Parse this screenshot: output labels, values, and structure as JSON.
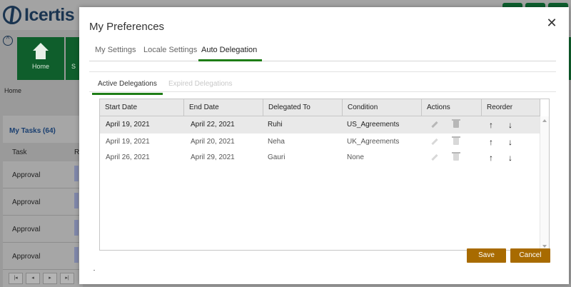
{
  "app": {
    "logo_text": "Icertis",
    "tiles": {
      "home": "Home",
      "second": "S"
    },
    "breadcrumb": "Home",
    "my_tasks": {
      "title": "My Tasks (64)",
      "columns": [
        "Task",
        "R"
      ],
      "rows": [
        {
          "task": "Approval"
        },
        {
          "task": "Approval"
        },
        {
          "task": "Approval"
        },
        {
          "task": "Approval"
        }
      ]
    }
  },
  "modal": {
    "title": "My Preferences",
    "close_glyph": "✕",
    "tabs": [
      "My Settings",
      "Locale Settings",
      "Auto Delegation"
    ],
    "active_tab": "Auto Delegation",
    "subtabs": [
      "Active Delegations",
      "Expired Delegations"
    ],
    "active_subtab": "Active Delegations",
    "grid": {
      "columns": [
        "Start Date",
        "End Date",
        "Delegated To",
        "Condition",
        "Actions",
        "Reorder"
      ],
      "rows": [
        {
          "start": "April 19, 2021",
          "end": "April 22, 2021",
          "to": "Ruhi",
          "condition": "US_Agreements"
        },
        {
          "start": "April 19, 2021",
          "end": "April 20, 2021",
          "to": "Neha",
          "condition": "UK_Agreements"
        },
        {
          "start": "April 26, 2021",
          "end": "April 29, 2021",
          "to": "Gauri",
          "condition": "None"
        }
      ]
    },
    "buttons": {
      "save": "Save",
      "cancel": "Cancel"
    },
    "colors": {
      "accent_green": "#1e7d16",
      "button_gold": "#a86b00"
    }
  }
}
